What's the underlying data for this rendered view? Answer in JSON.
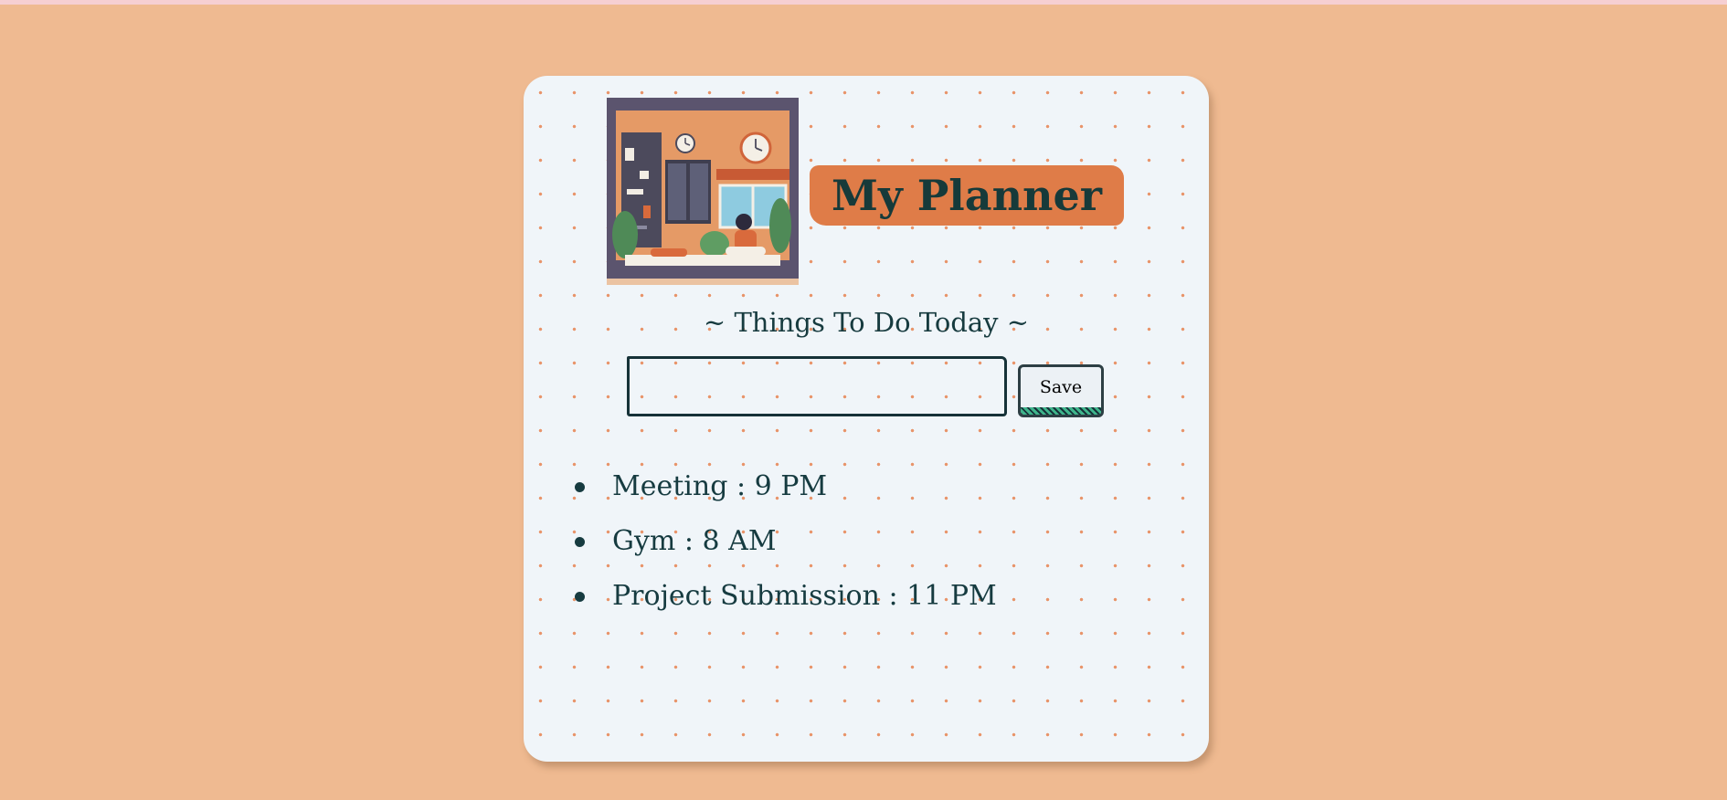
{
  "app": {
    "title": "My Planner",
    "subtitle": "~ Things To Do Today ~"
  },
  "form": {
    "input_value": "",
    "input_placeholder": "",
    "save_label": "Save"
  },
  "tasks": [
    {
      "text": "Meeting : 9 PM"
    },
    {
      "text": "Gym : 8 AM"
    },
    {
      "text": "Project Submission : 11 PM"
    }
  ],
  "colors": {
    "page_background": "#efba91",
    "card_background": "#f0f5f9",
    "accent": "#df7c48",
    "text": "#163b40",
    "save_stripe": "#3fb58c"
  },
  "icons": {
    "header_image": "room-illustration"
  }
}
